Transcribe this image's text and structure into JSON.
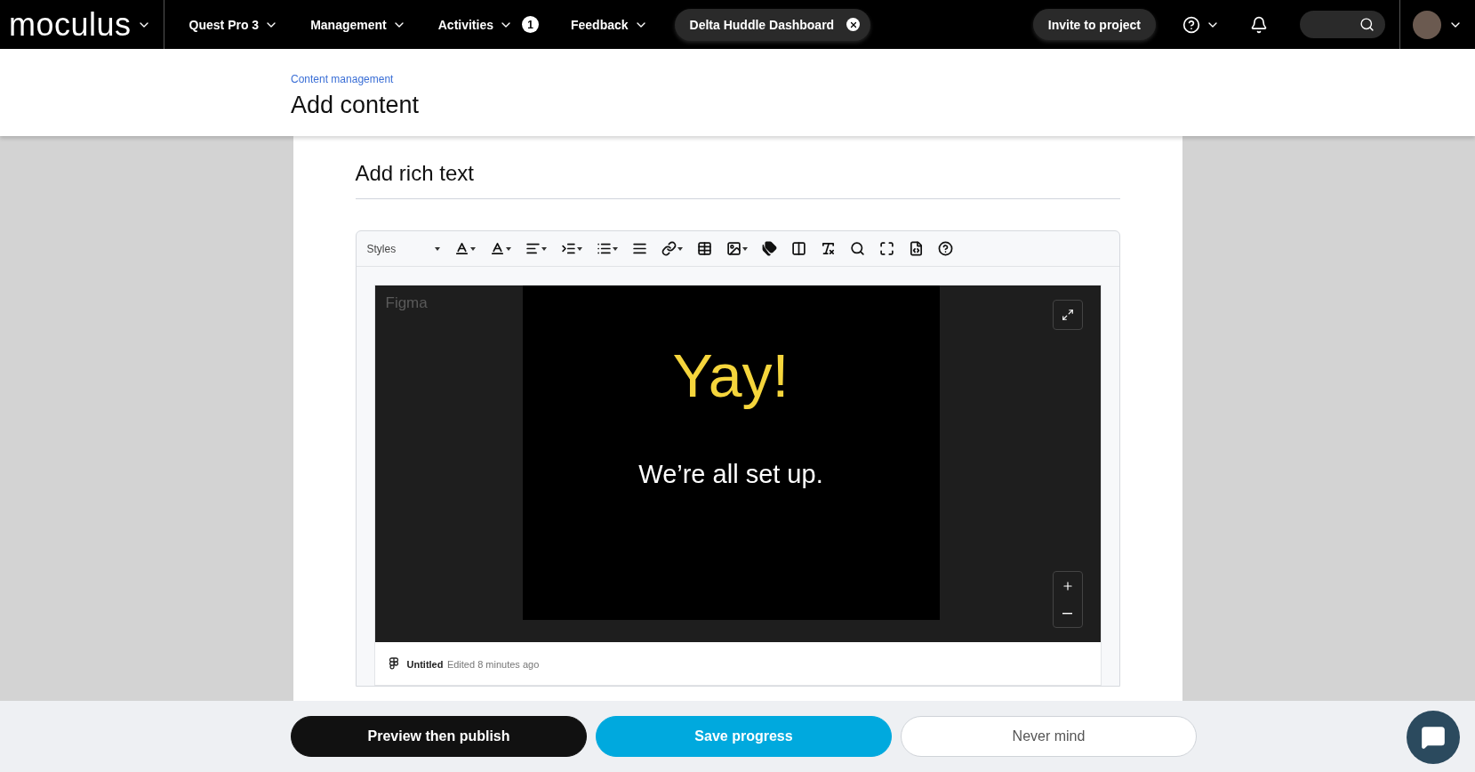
{
  "nav": {
    "logo": "moculus",
    "menus": [
      {
        "label": "Quest Pro 3"
      },
      {
        "label": "Management"
      },
      {
        "label": "Activities",
        "badge": "1"
      },
      {
        "label": "Feedback"
      }
    ],
    "chip": "Delta Huddle Dashboard",
    "invite": "Invite to project"
  },
  "header": {
    "breadcrumb": "Content management",
    "title": "Add content"
  },
  "section_title": "Add rich text",
  "editor": {
    "styles": "Styles",
    "tools": [
      {
        "kind": "font-color",
        "dropdown": true
      },
      {
        "kind": "background-color",
        "dropdown": true
      },
      {
        "kind": "align",
        "dropdown": true
      },
      {
        "kind": "indent",
        "dropdown": true
      },
      {
        "kind": "list",
        "dropdown": true
      },
      {
        "kind": "rule",
        "dropdown": false
      },
      {
        "kind": "link",
        "dropdown": true
      },
      {
        "kind": "table",
        "dropdown": false
      },
      {
        "kind": "image",
        "dropdown": true
      },
      {
        "kind": "tags",
        "dropdown": false
      },
      {
        "kind": "template",
        "dropdown": false
      },
      {
        "kind": "clear-format",
        "dropdown": false
      },
      {
        "kind": "search",
        "dropdown": false
      },
      {
        "kind": "fullscreen",
        "dropdown": false
      },
      {
        "kind": "source",
        "dropdown": false
      },
      {
        "kind": "help",
        "dropdown": false
      }
    ]
  },
  "embed": {
    "label": "Figma",
    "heading": "Yay!",
    "subheading": "We’re all set up.",
    "file": "Untitled",
    "edited": "Edited 8 minutes ago"
  },
  "actions": [
    {
      "label": "Preview then publish",
      "kind": "primary"
    },
    {
      "label": "Save progress",
      "kind": "accent"
    },
    {
      "label": "Never mind",
      "kind": "secondary"
    }
  ]
}
